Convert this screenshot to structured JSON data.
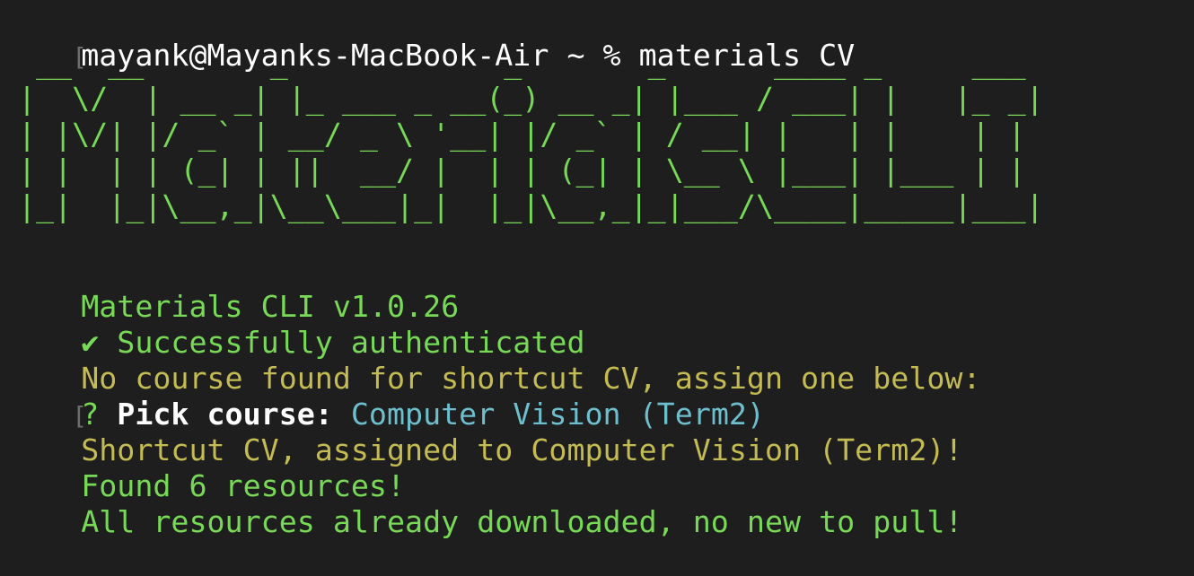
{
  "prompt": {
    "bracket": "[",
    "user_host": "mayank@Mayanks-MacBook-Air",
    "cwd": "~",
    "symbol": "%",
    "command": "materials CV"
  },
  "banner": {
    "lines": [
      "  __  __       _            _       _      ____ _     ___ ",
      " |  \\/  | __ _| |_ ___ _ __(_) __ _| |___ / ___| |   |_ _|",
      " | |\\/| |/ _` | __/ _ \\ '__| |/ _` | / __| |   | |    | | ",
      " | |  | | (_| | ||  __/ |  | | (_| | \\__ \\ |___| |___ | | ",
      " |_|  |_|\\__,_|\\__\\___|_|  |_|\\__,_|_|___/\\____|_____|___|"
    ]
  },
  "output": {
    "version": "Materials CLI v1.0.26",
    "auth_check": "✔",
    "auth_text": "Successfully authenticated",
    "no_course": "No course found for shortcut CV, assign one below:",
    "pick_bracket": "[",
    "pick_question": "?",
    "pick_label": "Pick course:",
    "pick_value": "Computer Vision (Term2)",
    "assigned": "Shortcut CV, assigned to Computer Vision (Term2)!",
    "found": "Found 6 resources!",
    "all_downloaded": "All resources already downloaded, no new to pull!"
  },
  "colors": {
    "background": "#1e1e1e",
    "green": "#78d957",
    "yellow": "#c4bb53",
    "cyan": "#6ebfce",
    "white": "#ffffff"
  }
}
